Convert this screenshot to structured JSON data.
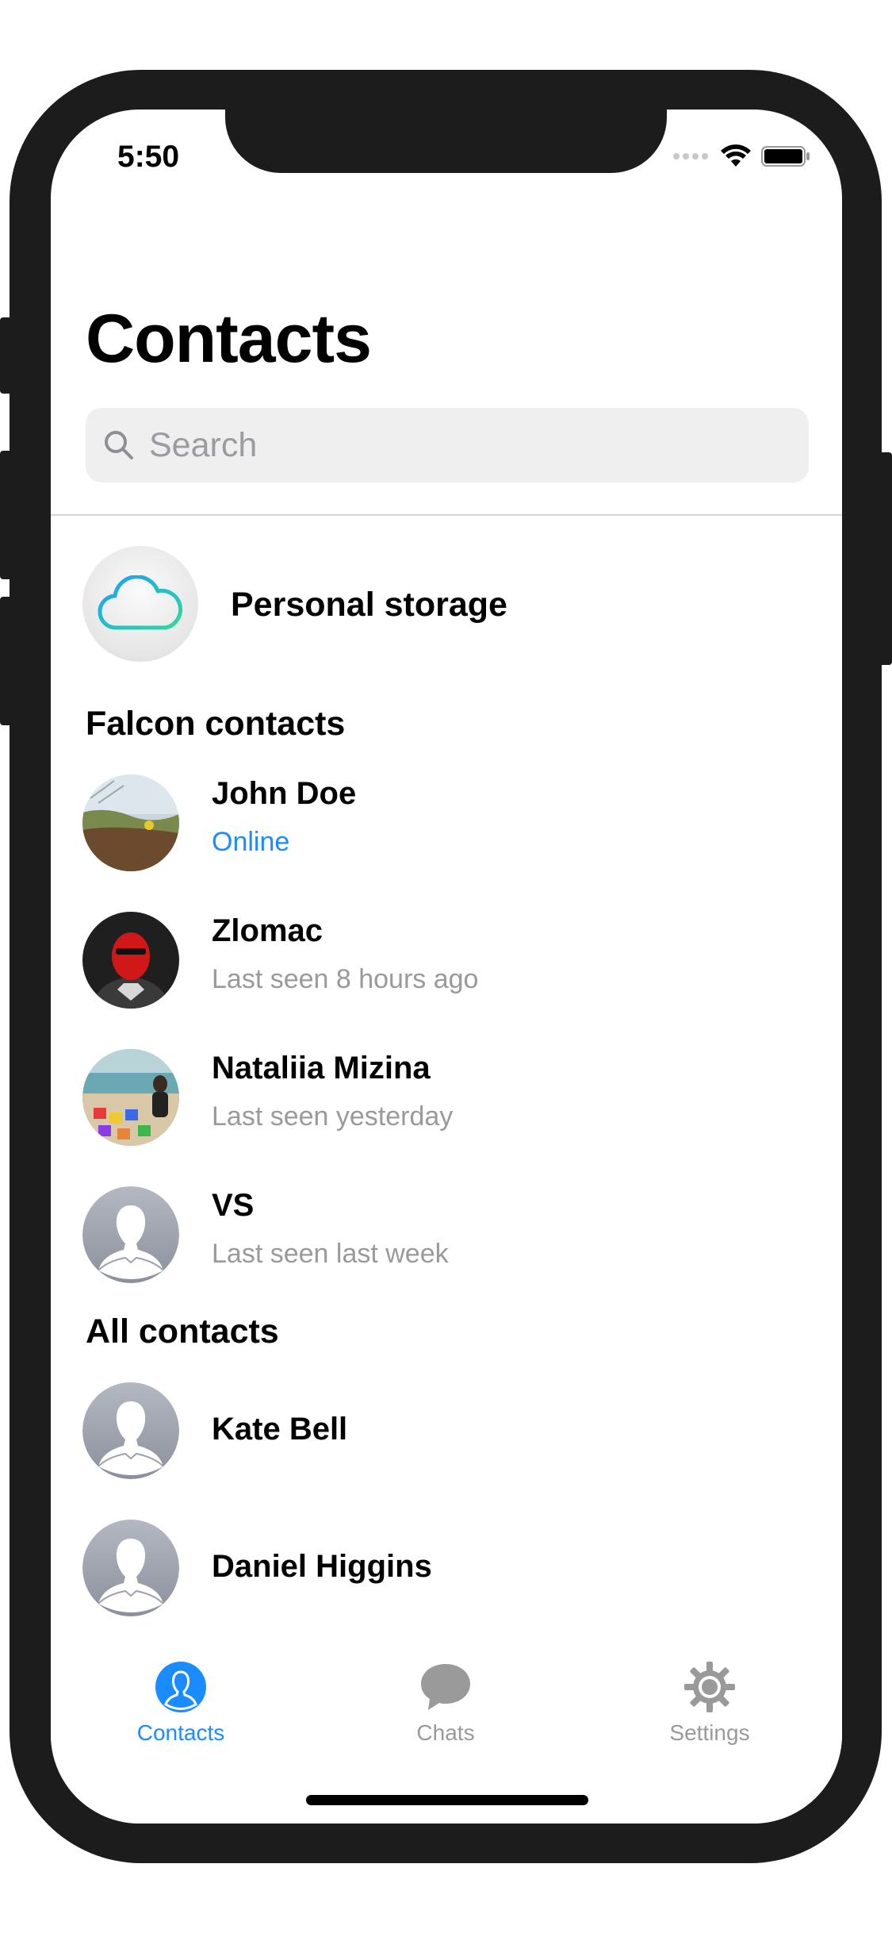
{
  "status_bar": {
    "time": "5:50"
  },
  "header": {
    "title": "Contacts"
  },
  "search": {
    "placeholder": "Search"
  },
  "personal_storage": {
    "label": "Personal storage"
  },
  "sections": {
    "falcon": {
      "title": "Falcon contacts",
      "contacts": [
        {
          "name": "John Doe",
          "status": "Online"
        },
        {
          "name": "Zlomac",
          "status": "Last seen 8 hours ago"
        },
        {
          "name": "Nataliia Mizina",
          "status": "Last seen yesterday"
        },
        {
          "name": "VS",
          "status": "Last seen last week"
        }
      ]
    },
    "all": {
      "title": "All contacts",
      "contacts": [
        {
          "name": "Kate Bell"
        },
        {
          "name": "Daniel Higgins"
        }
      ]
    }
  },
  "tab_bar": {
    "tabs": [
      {
        "label": "Contacts",
        "icon": "person-icon",
        "active": true
      },
      {
        "label": "Chats",
        "icon": "chat-bubble-icon",
        "active": false
      },
      {
        "label": "Settings",
        "icon": "gear-icon",
        "active": false
      }
    ]
  },
  "colors": {
    "accent": "#1a8cff",
    "inactive": "#9a9a9a",
    "online": "#1a8cff"
  }
}
